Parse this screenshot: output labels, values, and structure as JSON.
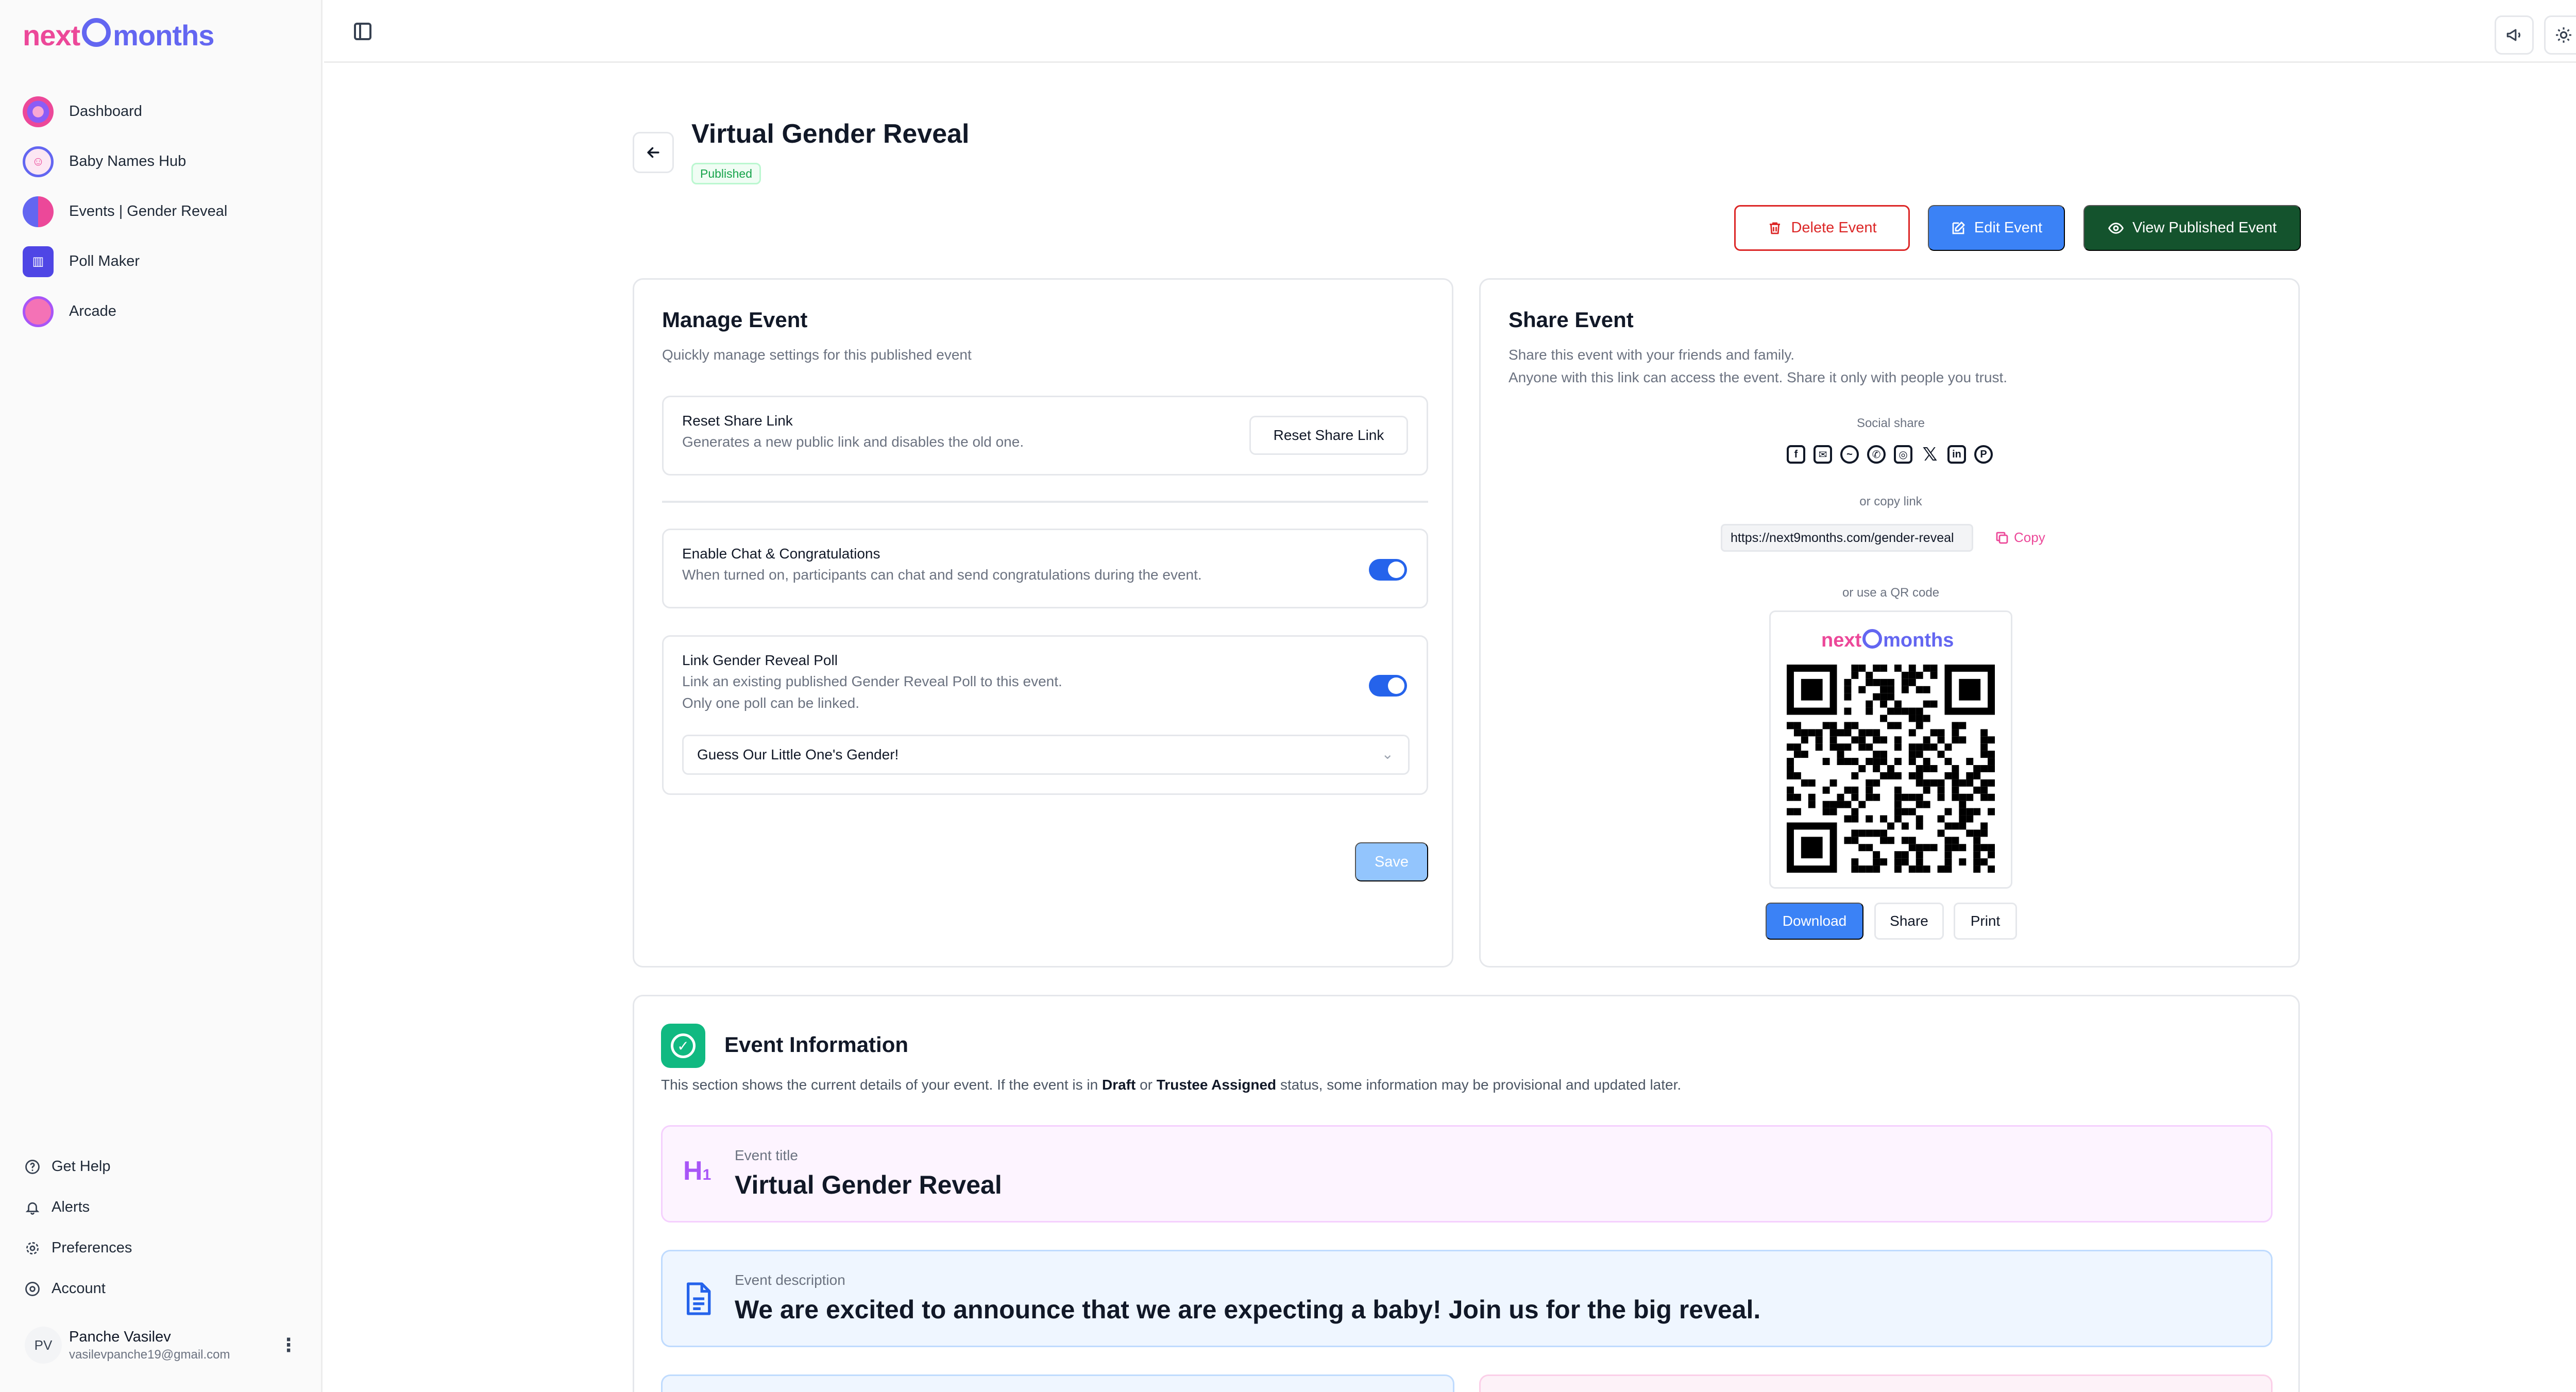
{
  "brand": {
    "logo_part1": "next",
    "logo_part2": "months"
  },
  "sidebar": {
    "items": [
      {
        "label": "Dashboard"
      },
      {
        "label": "Baby Names Hub"
      },
      {
        "label": "Events | Gender Reveal"
      },
      {
        "label": "Poll Maker"
      },
      {
        "label": "Arcade"
      }
    ],
    "bottom": [
      {
        "label": "Get Help"
      },
      {
        "label": "Alerts"
      },
      {
        "label": "Preferences"
      },
      {
        "label": "Account"
      }
    ],
    "user": {
      "initials": "PV",
      "name": "Panche Vasilev",
      "email": "vasilevpanche19@gmail.com"
    }
  },
  "header": {
    "title": "Virtual Gender Reveal",
    "status": "Published",
    "delete_label": "Delete Event",
    "edit_label": "Edit Event",
    "view_label": "View Published Event"
  },
  "manage": {
    "title": "Manage Event",
    "subtitle": "Quickly manage settings for this published event",
    "reset_title": "Reset Share Link",
    "reset_sub": "Generates a new public link and disables the old one.",
    "reset_button": "Reset Share Link",
    "chat_title": "Enable Chat & Congratulations",
    "chat_sub": "When turned on, participants can chat and send congratulations during the event.",
    "chat_enabled": true,
    "poll_title": "Link Gender Reveal Poll",
    "poll_sub1": "Link an existing published Gender Reveal Poll to this event.",
    "poll_sub2": "Only one poll can be linked.",
    "poll_enabled": true,
    "poll_selected": "Guess Our Little One's Gender!",
    "save_label": "Save"
  },
  "share": {
    "title": "Share Event",
    "sub1": "Share this event with your friends and family.",
    "sub2": "Anyone with this link can access the event. Share it only with people you trust.",
    "social_label": "Social share",
    "social_icons": [
      "facebook-icon",
      "email-icon",
      "messenger-icon",
      "whatsapp-icon",
      "instagram-icon",
      "x-icon",
      "linkedin-icon",
      "pinterest-icon"
    ],
    "copy_label": "or copy link",
    "link_value": "https://next9months.com/gender-reveal",
    "copy_button": "Copy",
    "qr_label": "or use a QR code",
    "download_label": "Download",
    "share_label": "Share",
    "print_label": "Print"
  },
  "info": {
    "title": "Event Information",
    "desc_pre": "This section shows the current details of your event. If the event is in ",
    "desc_b1": "Draft",
    "desc_mid": " or ",
    "desc_b2": "Trustee Assigned",
    "desc_post": " status, some information may be provisional and updated later.",
    "event_title_label": "Event title",
    "event_title_value": "Virtual Gender Reveal",
    "event_desc_label": "Event description",
    "event_desc_value": "We are excited to announce that we are expecting a baby! Join us for the big reveal."
  },
  "colors": {
    "accent_blue": "#3b82f6",
    "brand_pink": "#ec4899",
    "brand_indigo": "#6366f1",
    "success": "#10b981",
    "danger": "#dc2626",
    "dark_green": "#14532d"
  }
}
